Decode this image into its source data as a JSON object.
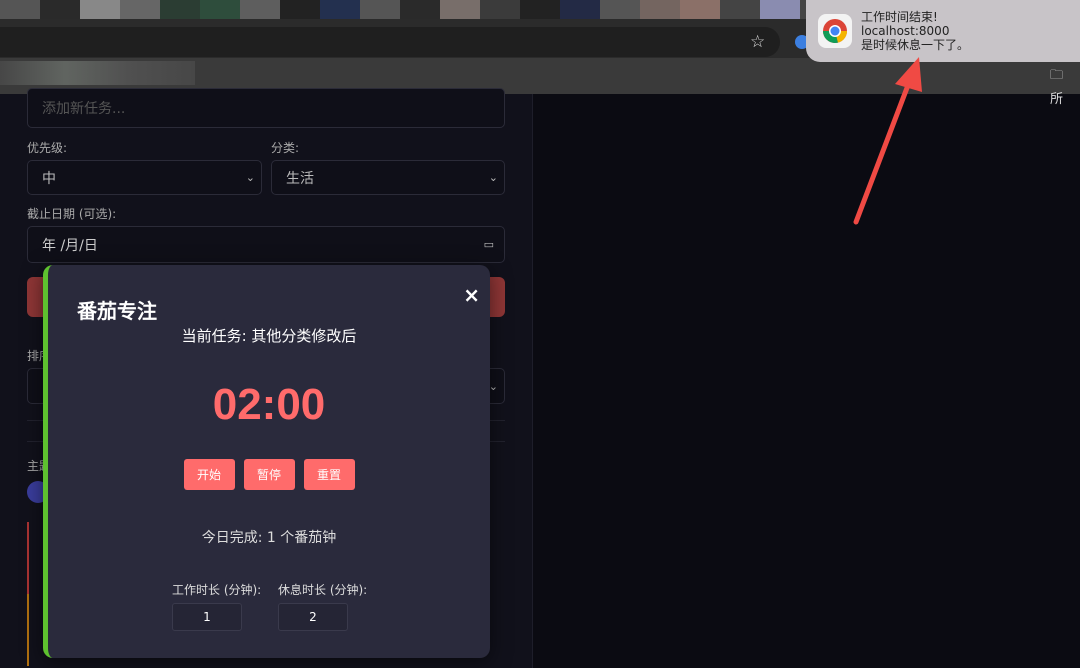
{
  "browser": {
    "star_icon": "star-icon",
    "bookmark_folder_label": "所"
  },
  "form": {
    "task_placeholder": "添加新任务...",
    "priority_label": "优先级:",
    "priority_value": "中",
    "category_label": "分类:",
    "category_value": "生活",
    "due_label": "截止日期 (可选):",
    "due_value": "年 /月/日",
    "sort_label": "排序",
    "theme_label": "主题"
  },
  "modal": {
    "title": "番茄专注",
    "close": "×",
    "current_task": "当前任务: 其他分类修改后",
    "timer": "02:00",
    "start": "开始",
    "pause": "暂停",
    "reset": "重置",
    "today_done": "今日完成: 1 个番茄钟",
    "work_label": "工作时长 (分钟):",
    "work_value": "1",
    "break_label": "休息时长 (分钟):",
    "break_value": "2"
  },
  "notification": {
    "title": "工作时间结束!",
    "source": "localhost:8000",
    "body": "是时候休息一下了。"
  },
  "colors": {
    "accent": "#ff6b6b",
    "modal_border": "#5ec12f",
    "arrow": "#f04a44"
  }
}
